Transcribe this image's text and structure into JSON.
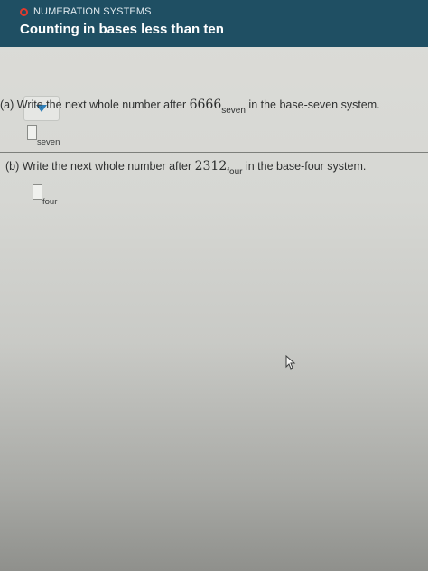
{
  "header": {
    "topic": "NUMERATION SYSTEMS",
    "title": "Counting in bases less than ten"
  },
  "questions": [
    {
      "prefix": "(a) Write the next whole number after",
      "number": "6666",
      "base_sub": "seven",
      "suffix": "in the base-seven system.",
      "answer_value": "",
      "answer_sub": "seven"
    },
    {
      "prefix": "(b) Write the next whole number after",
      "number": "2312",
      "base_sub": "four",
      "suffix": "in the base-four system.",
      "answer_value": "",
      "answer_sub": "four"
    }
  ],
  "icons": {
    "status": "circle-status-icon",
    "toggle": "chevron-down-icon",
    "cursor": "mouse-pointer-icon"
  },
  "colors": {
    "header_bg": "#1f4f63",
    "status_ring": "#e03a2e",
    "toggle_arrow": "#2f7fb8"
  }
}
